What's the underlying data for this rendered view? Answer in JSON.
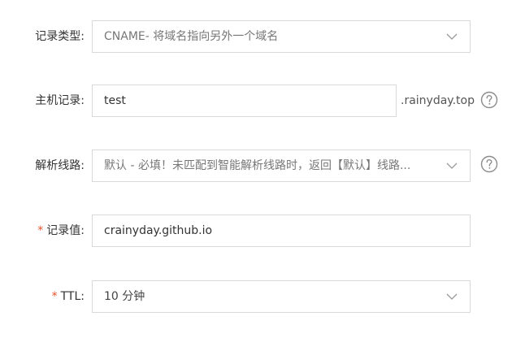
{
  "record_type": {
    "label": "记录类型:",
    "value": "CNAME- 将域名指向另外一个域名",
    "icon": "chevron-down-icon"
  },
  "host_record": {
    "label": "主机记录:",
    "value": "test",
    "suffix": ".rainyday.top",
    "help_icon": "question-circle-icon"
  },
  "resolve_line": {
    "label": "解析线路:",
    "value": "默认 - 必填！未匹配到智能解析线路时，返回【默认】线路...",
    "icon": "chevron-down-icon",
    "help_icon": "question-circle-icon"
  },
  "record_value": {
    "required_mark": "*",
    "label": "记录值:",
    "value": "crainyday.github.io"
  },
  "ttl": {
    "required_mark": "*",
    "label": "TTL:",
    "value": "10 分钟",
    "icon": "chevron-down-icon"
  },
  "colors": {
    "border": "#d9d9d9",
    "required": "#e5532b",
    "text": "#333333",
    "muted": "#777777"
  }
}
